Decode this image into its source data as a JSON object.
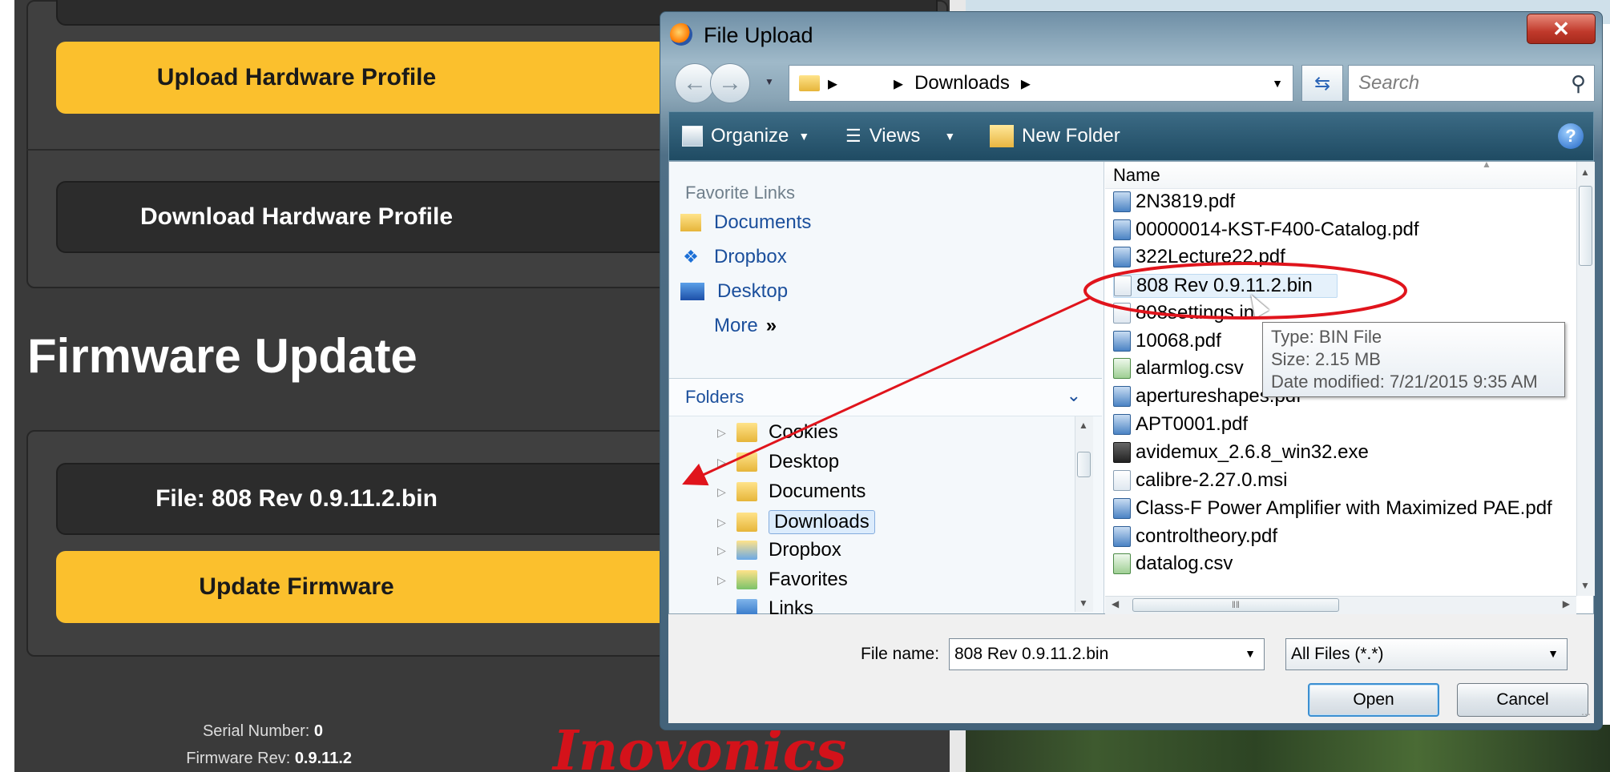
{
  "webpage": {
    "upload_profile_label": "Upload Hardware Profile",
    "download_profile_label": "Download Hardware Profile",
    "firmware_title": "Firmware Update",
    "file_label": "File: 808 Rev 0.9.11.2.bin",
    "update_firmware_label": "Update Firmware",
    "serial_label": "Serial Number: ",
    "serial_value": "0",
    "firmware_rev_label": "Firmware Rev: ",
    "firmware_rev_value": "0.9.11.2",
    "logo_text": "Inovonics"
  },
  "dialog": {
    "title": "File Upload",
    "close_label": "✕",
    "breadcrumb_arrow": "▸",
    "breadcrumb_current": "Downloads",
    "search_placeholder": "Search",
    "toolbar": {
      "organize": "Organize",
      "views": "Views",
      "new_folder": "New Folder",
      "help": "?"
    },
    "favorite_links_heading": "Favorite Links",
    "favorite_links": [
      "Documents",
      "Dropbox",
      "Desktop",
      "More"
    ],
    "more_chevron": "»",
    "folders_heading": "Folders",
    "folders": [
      "Cookies",
      "Desktop",
      "Documents",
      "Downloads",
      "Dropbox",
      "Favorites",
      "Links"
    ],
    "column_name": "Name",
    "files": [
      "2N3819.pdf",
      "00000014-KST-F400-Catalog.pdf",
      "322Lecture22.pdf",
      "808 Rev 0.9.11.2.bin",
      "808settings.ini",
      "10068.pdf",
      "alarmlog.csv",
      "apertureshapes.pdf",
      "APT0001.pdf",
      "avidemux_2.6.8_win32.exe",
      "calibre-2.27.0.msi",
      "Class-F Power Amplifier with Maximized PAE.pdf",
      "controltheory.pdf",
      "datalog.csv"
    ],
    "tooltip": {
      "type": "Type: BIN File",
      "size": "Size: 2.15 MB",
      "date": "Date modified: 7/21/2015 9:35 AM"
    },
    "file_name_label": "File name:",
    "file_name_value": "808 Rev 0.9.11.2.bin",
    "file_type": "All Files (*.*)",
    "open_label": "Open",
    "cancel_label": "Cancel"
  },
  "colors": {
    "accent_yellow": "#fbc02d",
    "page_bg": "#3a3a3a",
    "annotation_red": "#e0141c"
  }
}
